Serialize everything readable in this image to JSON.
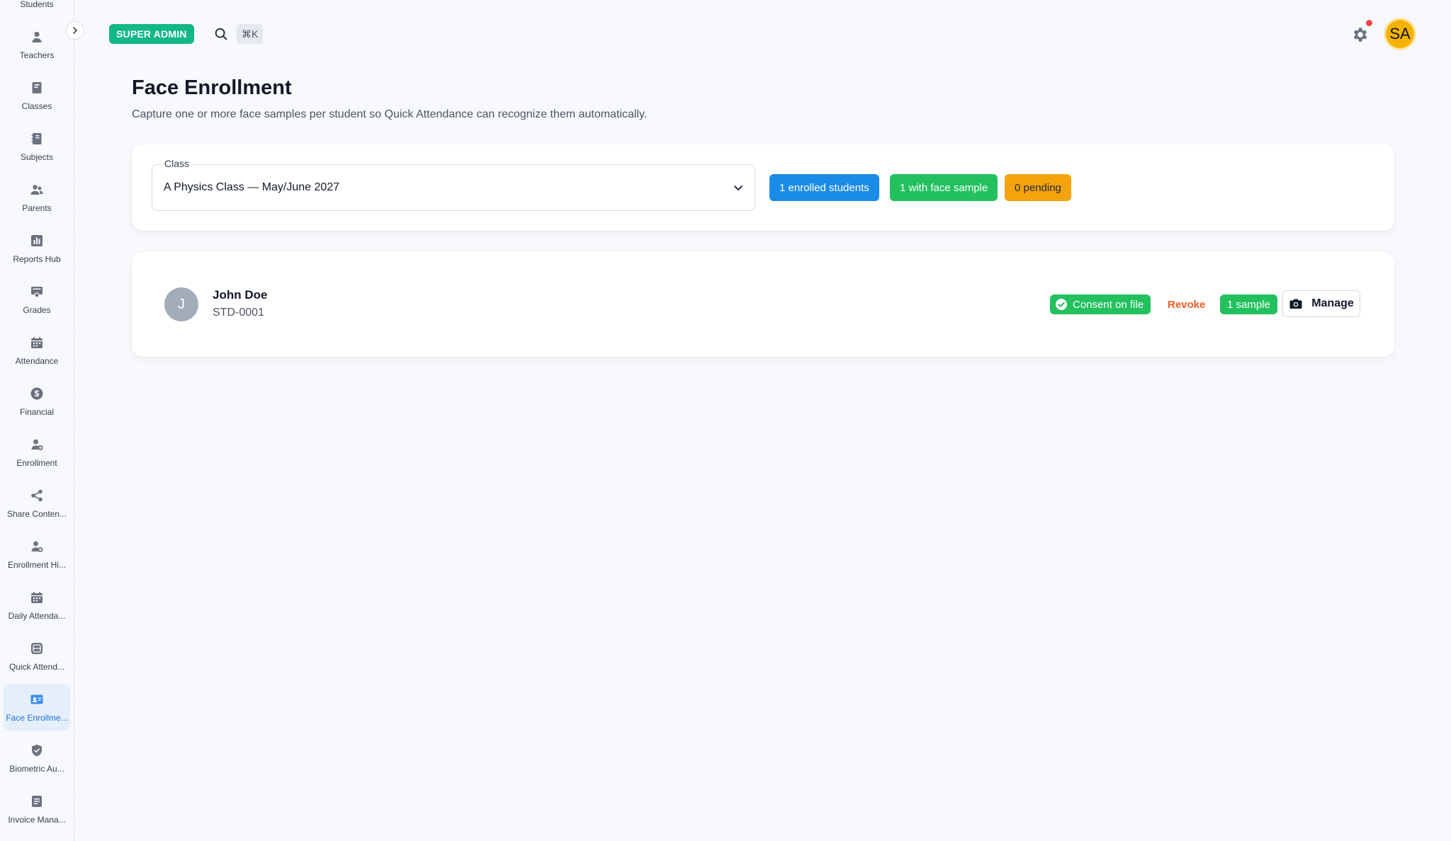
{
  "sidebar": {
    "items": [
      {
        "label": "Students",
        "icon": "user-icon"
      },
      {
        "label": "Teachers",
        "icon": "user-icon"
      },
      {
        "label": "Classes",
        "icon": "book-icon"
      },
      {
        "label": "Subjects",
        "icon": "notebook-icon"
      },
      {
        "label": "Parents",
        "icon": "users-icon"
      },
      {
        "label": "Reports Hub",
        "icon": "bar-chart-icon"
      },
      {
        "label": "Grades",
        "icon": "grade-icon"
      },
      {
        "label": "Attendance",
        "icon": "calendar-icon"
      },
      {
        "label": "Financial",
        "icon": "dollar-icon"
      },
      {
        "label": "Enrollment",
        "icon": "user-add-icon"
      },
      {
        "label": "Share Conten...",
        "icon": "share-icon"
      },
      {
        "label": "Enrollment Hi...",
        "icon": "user-add-icon"
      },
      {
        "label": "Daily Attenda...",
        "icon": "calendar-icon"
      },
      {
        "label": "Quick Attend...",
        "icon": "scan-icon"
      },
      {
        "label": "Face Enrollme...",
        "icon": "id-card-icon",
        "active": true
      },
      {
        "label": "Biometric Au...",
        "icon": "shield-icon"
      },
      {
        "label": "Invoice Mana...",
        "icon": "invoice-icon"
      }
    ]
  },
  "topbar": {
    "role_badge": "SUPER ADMIN",
    "shortcut": "⌘K",
    "avatar_initials": "SA"
  },
  "page": {
    "title": "Face Enrollment",
    "subtitle": "Capture one or more face samples per student so Quick Attendance can recognize them automatically."
  },
  "filter": {
    "class_label": "Class",
    "class_value": "A Physics Class — May/June 2027",
    "stats": {
      "enrolled": "1 enrolled students",
      "with_sample": "1 with face sample",
      "pending": "0 pending"
    }
  },
  "students": [
    {
      "initial": "J",
      "name": "John Doe",
      "id": "STD-0001",
      "consent": "Consent on file",
      "revoke": "Revoke",
      "samples": "1 sample",
      "manage": "Manage"
    }
  ],
  "colors": {
    "accent_blue": "#1a8be6",
    "success_green": "#22c15e",
    "warning_orange": "#f5a30b",
    "danger_orange": "#f25c22",
    "role_badge_teal": "#12b886",
    "avatar_yellow": "#f5b301"
  }
}
